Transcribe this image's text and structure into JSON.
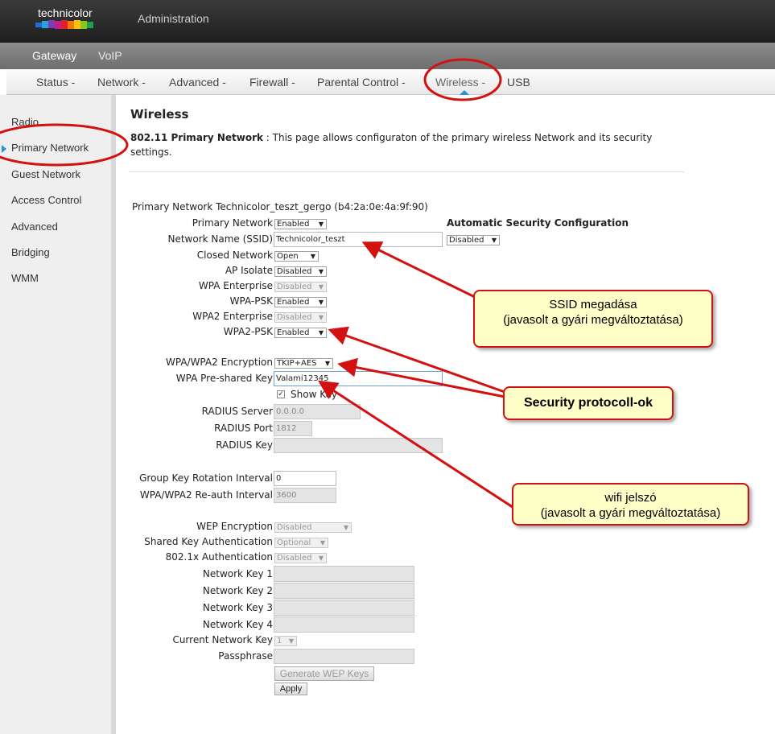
{
  "header": {
    "logo_text": "technicolor",
    "admin_title": "Administration"
  },
  "nav_primary": [
    "Gateway",
    "VoIP"
  ],
  "nav_secondary": [
    "Status -",
    "Network -",
    "Advanced -",
    "Firewall -",
    "Parental Control -",
    "Wireless -",
    "USB"
  ],
  "sidebar": [
    "Radio",
    "Primary Network",
    "Guest Network",
    "Access Control",
    "Advanced",
    "Bridging",
    "WMM"
  ],
  "page": {
    "title": "Wireless",
    "desc_bold": "802.11 Primary Network",
    "desc_text": "  :  This page allows configuraton of the primary wireless Network and its security settings.",
    "network_line": "Primary Network Technicolor_teszt_gergo (b4:2a:0e:4a:9f:90)",
    "auto_sec_label": "Automatic Security Configuration",
    "auto_sec_value": "Disabled"
  },
  "form": {
    "primary_network": {
      "label": "Primary Network",
      "value": "Enabled"
    },
    "ssid": {
      "label": "Network Name (SSID)",
      "value": "Technicolor_teszt"
    },
    "closed_network": {
      "label": "Closed Network",
      "value": "Open"
    },
    "ap_isolate": {
      "label": "AP Isolate",
      "value": "Disabled"
    },
    "wpa_enterprise": {
      "label": "WPA Enterprise",
      "value": "Disabled"
    },
    "wpa_psk": {
      "label": "WPA-PSK",
      "value": "Enabled"
    },
    "wpa2_enterprise": {
      "label": "WPA2 Enterprise",
      "value": "Disabled"
    },
    "wpa2_psk": {
      "label": "WPA2-PSK",
      "value": "Enabled"
    },
    "encryption": {
      "label": "WPA/WPA2 Encryption",
      "value": "TKIP+AES"
    },
    "psk": {
      "label": "WPA Pre-shared Key",
      "value": "Valami12345"
    },
    "show_key": {
      "label": "Show Key"
    },
    "radius_server": {
      "label": "RADIUS Server",
      "value": "0.0.0.0"
    },
    "radius_port": {
      "label": "RADIUS Port",
      "value": "1812"
    },
    "radius_key": {
      "label": "RADIUS Key",
      "value": ""
    },
    "group_key_rotation": {
      "label": "Group Key Rotation Interval",
      "value": "0"
    },
    "reauth_interval": {
      "label": "WPA/WPA2 Re-auth Interval",
      "value": "3600"
    },
    "wep_encryption": {
      "label": "WEP Encryption",
      "value": "Disabled"
    },
    "shared_key_auth": {
      "label": "Shared Key Authentication",
      "value": "Optional"
    },
    "dot1x_auth": {
      "label": "802.1x Authentication",
      "value": "Disabled"
    },
    "network_key_1": {
      "label": "Network Key 1"
    },
    "network_key_2": {
      "label": "Network Key 2"
    },
    "network_key_3": {
      "label": "Network Key 3"
    },
    "network_key_4": {
      "label": "Network Key 4"
    },
    "current_network_key": {
      "label": "Current Network Key",
      "value": "1"
    },
    "passphrase": {
      "label": "Passphrase"
    },
    "generate_wep_button": "Generate WEP Keys",
    "apply_button": "Apply"
  },
  "callouts": {
    "ssid": [
      "SSID megadása",
      "(javasolt a gyári megváltoztatása)"
    ],
    "security": "Security protocoll-ok",
    "wifi": [
      "wifi jelszó",
      "(javasolt a gyári megváltoztatása)"
    ]
  },
  "colors": {
    "annotation_red": "#d41111",
    "callout_fill": "#ffffc8",
    "accent_blue": "#2a8fd8"
  }
}
